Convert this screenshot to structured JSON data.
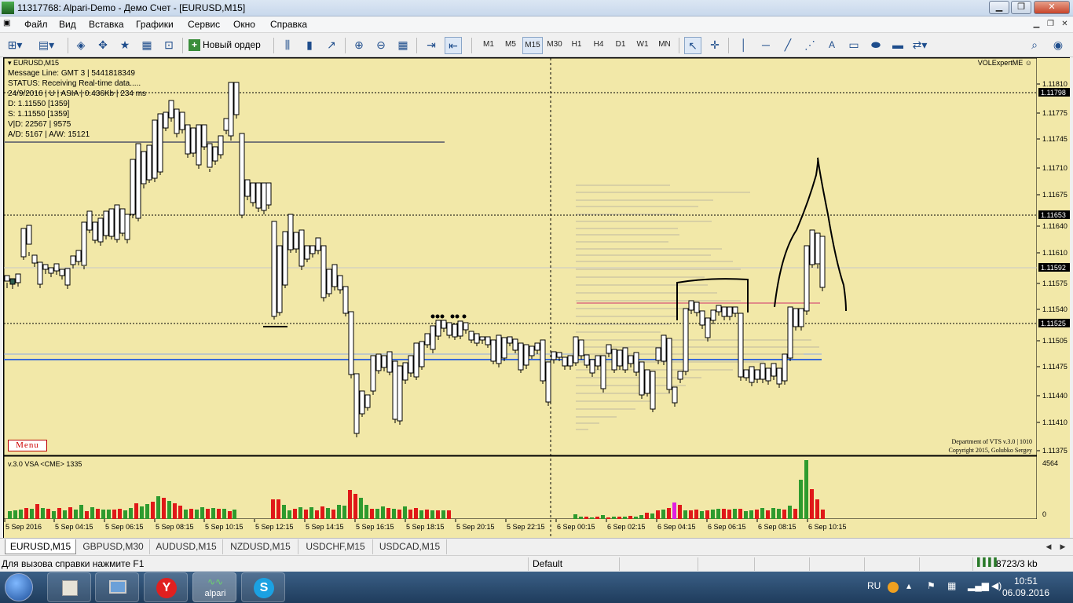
{
  "window": {
    "title": "11317768: Alpari-Demo - Демо Счет - [EURUSD,M15]"
  },
  "menu": {
    "items": [
      "Файл",
      "Вид",
      "Вставка",
      "Графики",
      "Сервис",
      "Окно",
      "Справка"
    ]
  },
  "toolbar": {
    "new_order": "Новый ордер",
    "timeframes": [
      "M1",
      "M5",
      "M15",
      "M30",
      "H1",
      "H4",
      "D1",
      "W1",
      "MN"
    ],
    "selected_timeframe": "M15",
    "object_letter": "A"
  },
  "chart": {
    "symbol_title": "EURUSD,M15",
    "expert_name": "VOLExpertME",
    "hud_lines": [
      "Message Line: GMT 3 | 5441818349",
      "STATUS:  Receiving Real-time data.....",
      "24/9/2016 | U | ASIA | 0.436Kb | 234 ms",
      "D: 1.11550  [1359]",
      "S: 1.11550  [1359]",
      "V|D: 22567 | 9575",
      "A/D: 5167 | A/W: 15121"
    ],
    "menu_button": "Menu",
    "copyright_lines": [
      "Department of VTS  v.3.0 | 1010",
      "Copyright 2015, Golubko Sergey"
    ],
    "subwindow_label": "v.3.0 VSA <CME> 1335",
    "volume_axis_max": "4564",
    "volume_axis_min": "0",
    "price_scale": [
      "1.11810",
      "1.11798",
      "1.11775",
      "1.11745",
      "1.11710",
      "1.11675",
      "1.11653",
      "1.11640",
      "1.11610",
      "1.11592",
      "1.11575",
      "1.11540",
      "1.11525",
      "1.11505",
      "1.11475",
      "1.11440",
      "1.11410",
      "1.11375"
    ],
    "highlighted_prices": [
      "1.11798",
      "1.11653",
      "1.11592",
      "1.11525"
    ],
    "time_labels": [
      "5 Sep 2016",
      "5 Sep 04:15",
      "5 Sep 06:15",
      "5 Sep 08:15",
      "5 Sep 10:15",
      "5 Sep 12:15",
      "5 Sep 14:15",
      "5 Sep 16:15",
      "5 Sep 18:15",
      "5 Sep 20:15",
      "5 Sep 22:15",
      "6 Sep 00:15",
      "6 Sep 02:15",
      "6 Sep 04:15",
      "6 Sep 06:15",
      "6 Sep 08:15",
      "6 Sep 10:15"
    ],
    "colors": {
      "background": "#f2e8a8",
      "bull": "#ffffff",
      "bear": "#2f5f50",
      "vol_up": "#2e9b2e",
      "vol_down": "#e01818",
      "vol_climax": "#e020e0",
      "level_line": "#3a6bd8",
      "red_line": "#d0306a"
    }
  },
  "tabs": [
    "EURUSD,M15",
    "GBPUSD,M30",
    "AUDUSD,M15",
    "NZDUSD,M15",
    "USDCHF,M15",
    "USDCAD,M15"
  ],
  "status": {
    "help": "Для вызова справки нажмите F1",
    "profile": "Default",
    "traffic": "8723/3 kb"
  },
  "taskbar": {
    "lang": "RU",
    "time": "10:51",
    "date": "06.09.2016",
    "apps": [
      "explorer-app",
      "calculator-app",
      "remote-desktop-app",
      "yandex-browser-app",
      "alpari-terminal-app",
      "skype-app"
    ],
    "alpari_label": "alpari"
  }
}
